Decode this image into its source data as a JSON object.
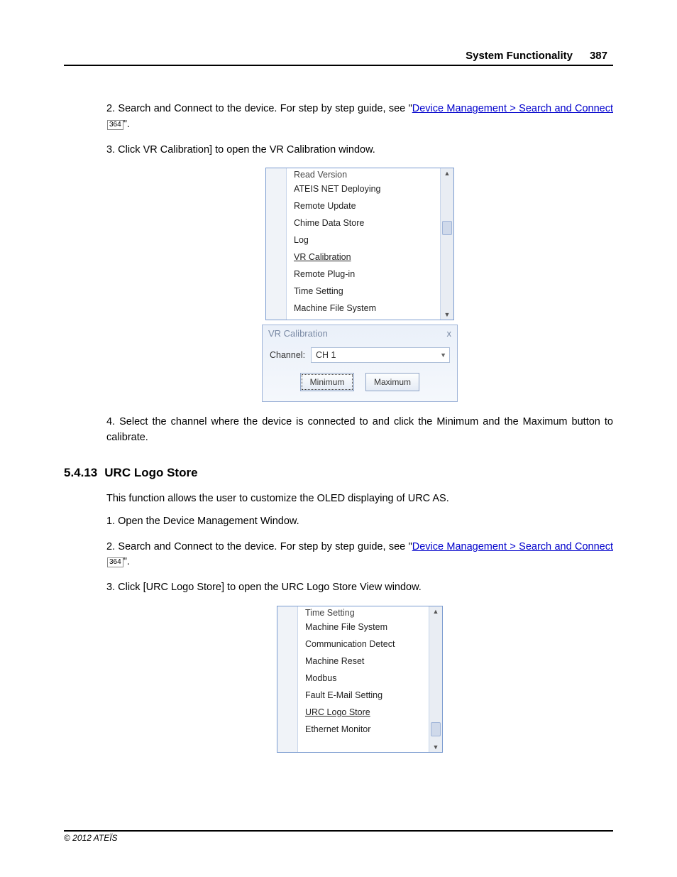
{
  "header": {
    "title": "System Functionality",
    "page_number": "387"
  },
  "steps_top": {
    "step2_pre": "2. Search and Connect to the device. For step by step guide, see \"",
    "step2_link": "Device Management > Search and Connect",
    "step2_ref": "364",
    "step2_post": "\".",
    "step3": "3. Click VR Calibration] to open the VR Calibration window.",
    "step4": "4. Select the channel where the device is connected to and click the Minimum and the Maximum button to calibrate."
  },
  "menu1": {
    "cut_top": "Read Version",
    "items": [
      "ATEIS NET Deploying",
      "Remote Update",
      "Chime Data Store",
      "Log",
      "VR Calibration",
      "Remote Plug-in",
      "Time Setting",
      "Machine File System"
    ],
    "selected_index": 4
  },
  "dialog": {
    "title": "VR Calibration",
    "close": "x",
    "channel_label": "Channel:",
    "channel_value": "CH 1",
    "btn_min": "Minimum",
    "btn_max": "Maximum"
  },
  "section": {
    "number": "5.4.13",
    "title": "URC Logo Store"
  },
  "intro": "This function allows the user to customize the OLED displaying of URC AS.",
  "steps_bottom": {
    "step1": "1. Open the Device Management Window.",
    "step2_pre": "2. Search and Connect to the device. For step by step guide, see \"",
    "step2_link": "Device Management > Search and Connect",
    "step2_ref": "364",
    "step2_post": "\".",
    "step3": "3. Click [URC Logo Store] to open the URC Logo Store View window."
  },
  "menu2": {
    "cut_top": "Time Setting",
    "items": [
      "Machine File System",
      "Communication Detect",
      "Machine Reset",
      "Modbus",
      "Fault E-Mail Setting",
      "URC Logo Store",
      "Ethernet Monitor"
    ],
    "selected_index": 5
  },
  "footer": "© 2012 ATEÏS"
}
